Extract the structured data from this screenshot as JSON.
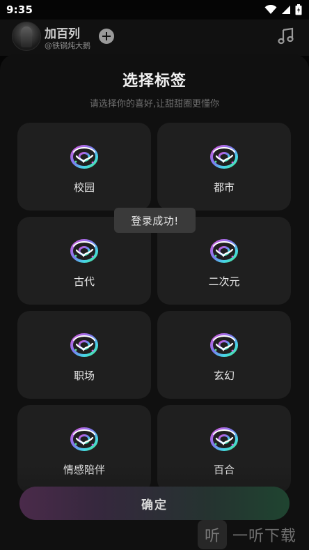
{
  "status_bar": {
    "time": "9:35"
  },
  "header": {
    "artist_name": "加百列",
    "artist_handle": "@铁锅炖大鹅"
  },
  "sheet": {
    "title": "选择标签",
    "subtitle": "请选择你的喜好,让甜甜圈更懂你",
    "tags": [
      {
        "label": "校园"
      },
      {
        "label": "都市"
      },
      {
        "label": "古代"
      },
      {
        "label": "二次元"
      },
      {
        "label": "职场"
      },
      {
        "label": "玄幻"
      },
      {
        "label": "情感陪伴"
      },
      {
        "label": "百合"
      }
    ],
    "confirm_label": "确定"
  },
  "toast": {
    "text": "登录成功!"
  },
  "watermark": {
    "logo_char": "听",
    "text": "一听下载"
  },
  "colors": {
    "card_bg": "#1f1f1f",
    "sheet_bg": "#101010",
    "accent_pink": "#d65ad8",
    "accent_cyan": "#45d6e6",
    "accent_green": "#4fe08a"
  },
  "icons": {
    "tag_icon": "donut-logo-icon",
    "follow_icon": "plus-icon",
    "music_icon": "music-note-icon"
  }
}
